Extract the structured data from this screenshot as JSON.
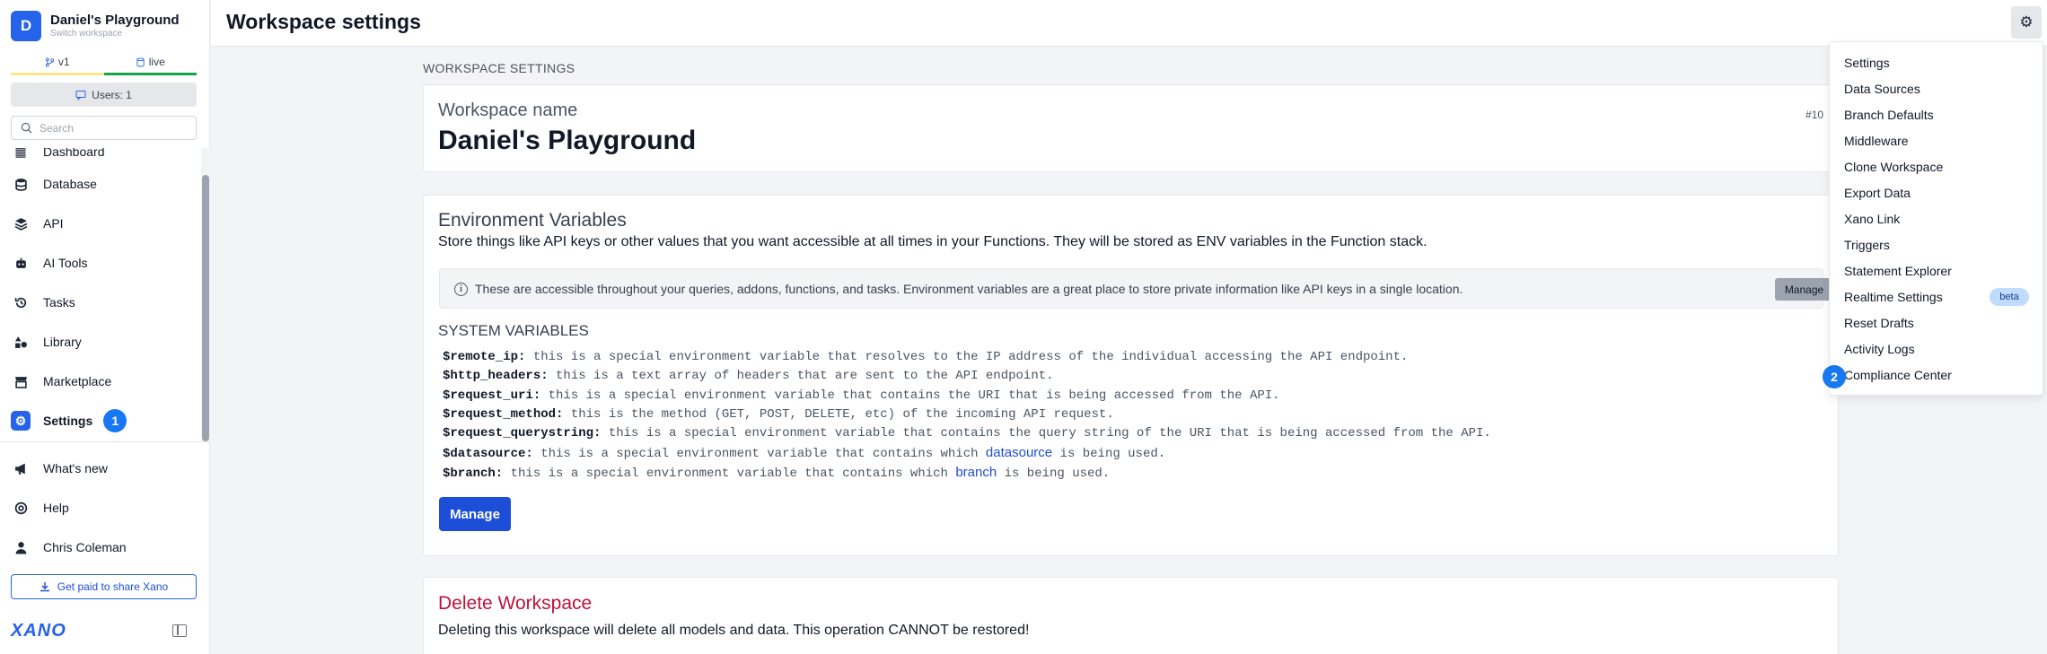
{
  "workspace": {
    "avatar_letter": "D",
    "name": "Daniel's Playground",
    "switch_label": "Switch workspace"
  },
  "branch": {
    "version": "v1",
    "environment": "live"
  },
  "users_label": "Users: 1",
  "search": {
    "placeholder": "Search"
  },
  "nav": {
    "partial_item": "Dashboard",
    "items": [
      {
        "label": "Database",
        "icon": "database-icon"
      },
      {
        "label": "API",
        "icon": "layers-icon"
      },
      {
        "label": "AI Tools",
        "icon": "robot-icon"
      },
      {
        "label": "Tasks",
        "icon": "history-icon"
      },
      {
        "label": "Library",
        "icon": "shapes-icon"
      },
      {
        "label": "Marketplace",
        "icon": "store-icon"
      },
      {
        "label": "Settings",
        "icon": "gear-icon",
        "active": true,
        "badge": "1"
      }
    ],
    "bottom_items": [
      {
        "label": "What's new",
        "icon": "megaphone-icon"
      },
      {
        "label": "Help",
        "icon": "help-icon"
      },
      {
        "label": "Chris Coleman",
        "icon": "user-icon"
      }
    ]
  },
  "share_button": "Get paid to share Xano",
  "logo_text": "XANO",
  "header": {
    "title": "Workspace settings"
  },
  "section_label": "WORKSPACE SETTINGS",
  "workspace_card": {
    "label": "Workspace name",
    "value": "Daniel's Playground",
    "id": "#10"
  },
  "env": {
    "title": "Environment Variables",
    "description": "Store things like API keys or other values that you want accessible at all times in your Functions. They will be stored as ENV variables in the Function stack.",
    "info": "These are accessible throughout your queries, addons, functions, and tasks. Environment variables are a great place to store private information like API keys in a single location.",
    "info_button": "Manage",
    "system_title": "SYSTEM VARIABLES",
    "variables": [
      {
        "name": "$remote_ip:",
        "desc": " this is a special environment variable that resolves to the IP address of the individual accessing the API endpoint."
      },
      {
        "name": "$http_headers:",
        "desc": " this is a text array of headers that are sent to the API endpoint."
      },
      {
        "name": "$request_uri:",
        "desc": " this is a special environment variable that contains the URI that is being accessed from the API."
      },
      {
        "name": "$request_method:",
        "desc": " this is the method (GET, POST, DELETE, etc) of the incoming API request."
      },
      {
        "name": "$request_querystring:",
        "desc": " this is a special environment variable that contains the query string of the URI that is being accessed from the API."
      },
      {
        "name": "$datasource:",
        "desc": " this is a special environment variable that contains which ",
        "link": "datasource",
        "after": " is being used."
      },
      {
        "name": "$branch:",
        "desc": " this is a special environment variable that contains which ",
        "link": "branch",
        "after": " is being used."
      }
    ],
    "manage_button": "Manage"
  },
  "delete": {
    "title": "Delete Workspace",
    "description": "Deleting this workspace will delete all models and data. This operation CANNOT be restored!"
  },
  "dropdown": {
    "items": [
      "Settings",
      "Data Sources",
      "Branch Defaults",
      "Middleware",
      "Clone Workspace",
      "Export Data",
      "Xano Link",
      "Triggers",
      "Statement Explorer",
      "Realtime Settings",
      "Reset Drafts",
      "Activity Logs",
      "Compliance Center"
    ],
    "beta_label": "beta",
    "compliance_badge": "2"
  },
  "colors": {
    "accent": "#2563eb",
    "badge": "#1877f2",
    "danger": "#be123c",
    "live": "#16a34a"
  }
}
